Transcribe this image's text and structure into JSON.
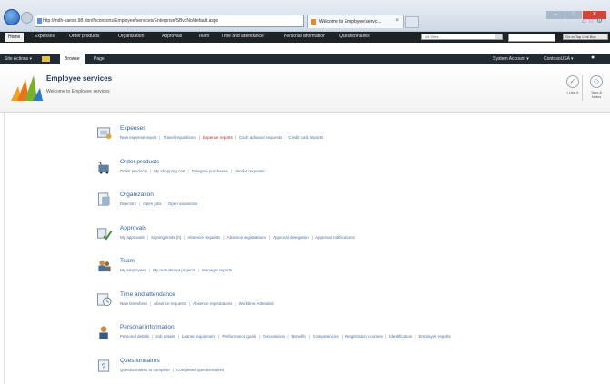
{
  "browser": {
    "url": "http://mdh-kaesn.98.nbn/fkconsons/Employee/services/Enterprise/SBvcNo/default.aspx",
    "tab_title": "Welcome to Employee servic...",
    "window_buttons": [
      "–",
      "□",
      "✕"
    ],
    "toolbar_icons": [
      "home-icon",
      "star-icon",
      "gear-icon"
    ]
  },
  "top_nav": {
    "items": [
      "Home",
      "Expenses",
      "Order products",
      "Organization",
      "Approvals",
      "Team",
      "Time and attendance",
      "Personal information",
      "Questionnaires"
    ],
    "search_placeholder": "All Sites",
    "go_label": "Go to Top Link Box"
  },
  "ribbon": {
    "site_actions": "Site Actions ▾",
    "tabs": [
      "Browse",
      "Page"
    ],
    "user": "System Account ▾",
    "user2": "ContosoUSA ▾"
  },
  "header": {
    "title": "Employee services",
    "subtitle": "Welcome to Employee services",
    "buttons": [
      "I Like It",
      "Tags & Notes"
    ]
  },
  "sections": [
    {
      "title": "Expenses",
      "icon": "expenses-icon",
      "links": [
        "New expense report",
        "Travel requisitions",
        "Expense reports",
        "Cash advance requests",
        "Credit card imports"
      ],
      "selected": 2
    },
    {
      "title": "Order products",
      "icon": "order-products-icon",
      "links": [
        "Order products",
        "My shopping cart",
        "Delegate purchases",
        "Vendor requests"
      ],
      "selected": -1
    },
    {
      "title": "Organization",
      "icon": "organization-icon",
      "links": [
        "Directory",
        "Open jobs",
        "Open vacancies"
      ],
      "selected": -1
    },
    {
      "title": "Approvals",
      "icon": "approvals-icon",
      "links": [
        "My approvals",
        "Signing limits (0)",
        "Absence requests",
        "Absence registrations",
        "Approval delegation",
        "Approval notifications"
      ],
      "selected": -1
    },
    {
      "title": "Team",
      "icon": "team-icon",
      "links": [
        "My employees",
        "My recruitment projects",
        "Manager reports"
      ],
      "selected": -1
    },
    {
      "title": "Time and attendance",
      "icon": "time-attendance-icon",
      "links": [
        "New timesheet",
        "Absence requests",
        "Absence registrations",
        "Worktime Attended"
      ],
      "selected": -1
    },
    {
      "title": "Personal information",
      "icon": "personal-information-icon",
      "links": [
        "Personal details",
        "Job details",
        "Loaned equipment",
        "Performance goals",
        "Discussions",
        "Benefits",
        "Competencies",
        "Registration courses",
        "Identification",
        "Employee reports"
      ],
      "selected": -1
    },
    {
      "title": "Questionnaires",
      "icon": "questionnaires-icon",
      "links": [
        "Questionnaires to complete",
        "Completed questionnaires"
      ],
      "selected": -1
    }
  ]
}
